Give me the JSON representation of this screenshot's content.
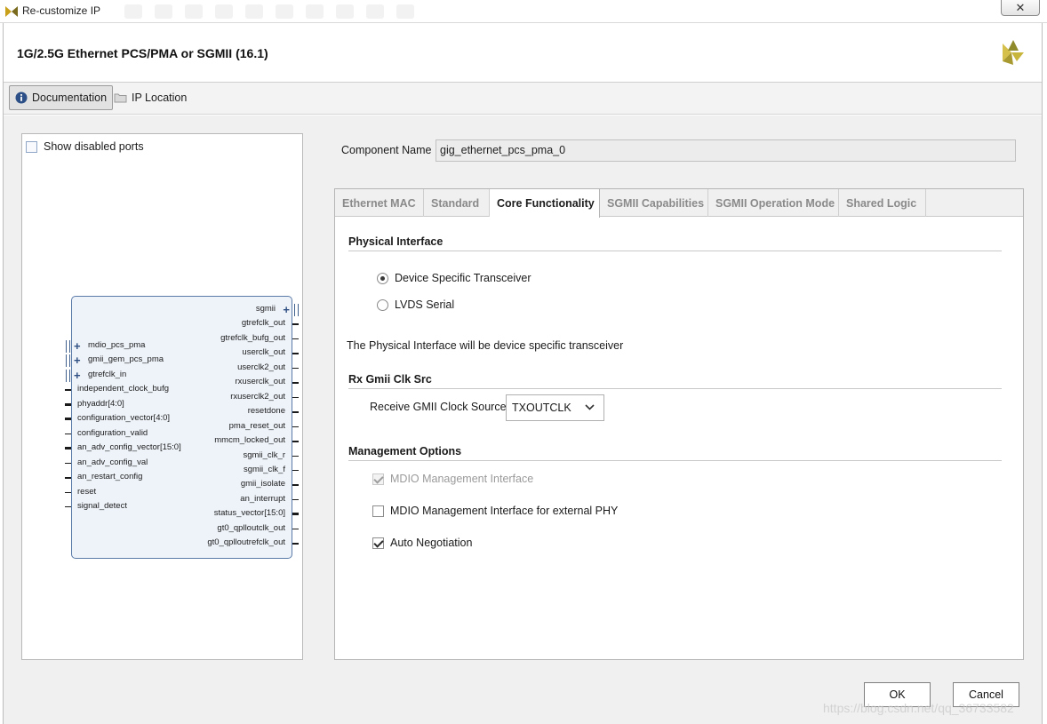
{
  "window": {
    "title": "Re-customize IP",
    "close_symbol": "✕"
  },
  "header": {
    "title": "1G/2.5G Ethernet PCS/PMA or SGMII (16.1)",
    "logo_icon": "xilinx-logo-icon"
  },
  "toolbar": {
    "documentation_label": "Documentation",
    "ip_location_label": "IP Location"
  },
  "left_panel": {
    "show_disabled_ports_label": "Show disabled ports",
    "show_disabled_ports_checked": false,
    "inputs": [
      {
        "name": "mdio_pcs_pma",
        "kind": "interface"
      },
      {
        "name": "gmii_gem_pcs_pma",
        "kind": "interface"
      },
      {
        "name": "gtrefclk_in",
        "kind": "interface"
      },
      {
        "name": "independent_clock_bufg",
        "kind": "wire"
      },
      {
        "name": "phyaddr[4:0]",
        "kind": "bus"
      },
      {
        "name": "configuration_vector[4:0]",
        "kind": "bus"
      },
      {
        "name": "configuration_valid",
        "kind": "wire"
      },
      {
        "name": "an_adv_config_vector[15:0]",
        "kind": "bus"
      },
      {
        "name": "an_adv_config_val",
        "kind": "wire"
      },
      {
        "name": "an_restart_config",
        "kind": "wire"
      },
      {
        "name": "reset",
        "kind": "wire"
      },
      {
        "name": "signal_detect",
        "kind": "wire"
      }
    ],
    "outputs": [
      {
        "name": "sgmii",
        "kind": "interface"
      },
      {
        "name": "gtrefclk_out",
        "kind": "wire"
      },
      {
        "name": "gtrefclk_bufg_out",
        "kind": "wire"
      },
      {
        "name": "userclk_out",
        "kind": "wire"
      },
      {
        "name": "userclk2_out",
        "kind": "wire"
      },
      {
        "name": "rxuserclk_out",
        "kind": "wire"
      },
      {
        "name": "rxuserclk2_out",
        "kind": "wire"
      },
      {
        "name": "resetdone",
        "kind": "wire"
      },
      {
        "name": "pma_reset_out",
        "kind": "wire"
      },
      {
        "name": "mmcm_locked_out",
        "kind": "wire"
      },
      {
        "name": "sgmii_clk_r",
        "kind": "wire"
      },
      {
        "name": "sgmii_clk_f",
        "kind": "wire"
      },
      {
        "name": "gmii_isolate",
        "kind": "wire"
      },
      {
        "name": "an_interrupt",
        "kind": "wire"
      },
      {
        "name": "status_vector[15:0]",
        "kind": "bus"
      },
      {
        "name": "gt0_qplloutclk_out",
        "kind": "wire"
      },
      {
        "name": "gt0_qplloutrefclk_out",
        "kind": "wire"
      }
    ]
  },
  "component": {
    "label": "Component Name",
    "value": "gig_ethernet_pcs_pma_0"
  },
  "tabs": [
    {
      "label": "Ethernet MAC",
      "active": false
    },
    {
      "label": "Standard",
      "active": false
    },
    {
      "label": "Core Functionality",
      "active": true
    },
    {
      "label": "SGMII Capabilities",
      "active": false
    },
    {
      "label": "SGMII Operation Mode",
      "active": false
    },
    {
      "label": "Shared Logic",
      "active": false
    }
  ],
  "core_functionality": {
    "physical_interface": {
      "title": "Physical Interface",
      "options": [
        {
          "label": "Device Specific Transceiver",
          "selected": true
        },
        {
          "label": "LVDS Serial",
          "selected": false
        }
      ],
      "description": "The Physical Interface will be device specific transceiver"
    },
    "rx_gmii": {
      "title": "Rx Gmii Clk Src",
      "field_label": "Receive GMII Clock Source",
      "selected_value": "TXOUTCLK"
    },
    "management": {
      "title": "Management Options",
      "options": [
        {
          "label": "MDIO Management Interface",
          "checked": true,
          "disabled": true
        },
        {
          "label": "MDIO Management Interface for external PHY",
          "checked": false,
          "disabled": false
        },
        {
          "label": "Auto Negotiation",
          "checked": true,
          "disabled": false
        }
      ]
    }
  },
  "footer": {
    "ok_label": "OK",
    "cancel_label": "Cancel"
  },
  "watermark": "https://blog.csdn.net/qq_36733582",
  "colors": {
    "symbol_fill": "#eef3fa",
    "symbol_border": "#5a7ba8",
    "accent": "#2f4f82"
  }
}
